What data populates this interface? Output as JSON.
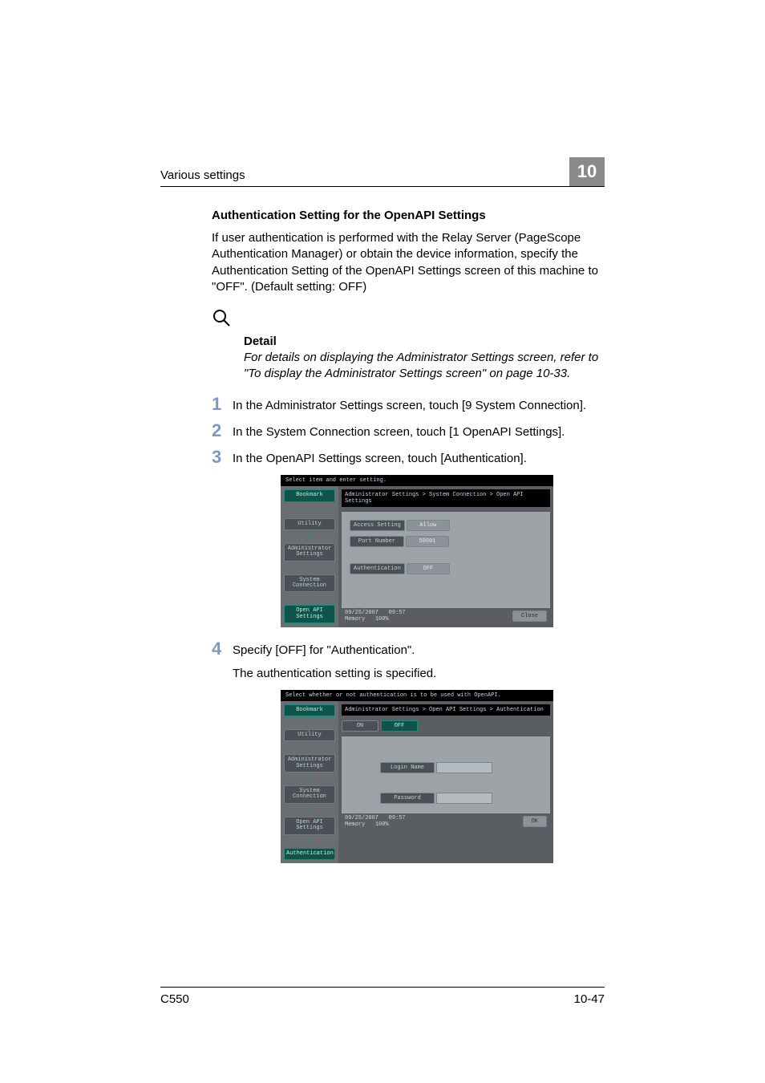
{
  "header": {
    "section": "Various settings",
    "chapter_number": "10"
  },
  "heading": "Authentication Setting for the OpenAPI Settings",
  "intro": "If user authentication is performed with the Relay Server (PageScope Authentication Manager) or obtain the device information, specify the Authentication Setting of the OpenAPI Settings screen of this machine to \"OFF\". (Default setting: OFF)",
  "detail": {
    "title": "Detail",
    "body": "For details on displaying the Administrator Settings screen, refer to \"To display the Administrator Settings screen\" on page 10-33."
  },
  "steps": {
    "s1": {
      "n": "1",
      "t": "In the Administrator Settings screen, touch [9 System Connection]."
    },
    "s2": {
      "n": "2",
      "t": "In the System Connection screen, touch [1 OpenAPI Settings]."
    },
    "s3": {
      "n": "3",
      "t": "In the OpenAPI Settings screen, touch [Authentication]."
    },
    "s4": {
      "n": "4",
      "t": "Specify [OFF] for \"Authentication\"."
    },
    "s4b": "The authentication setting is specified."
  },
  "shot1": {
    "title": "Select item and enter setting.",
    "breadcrumb": "Administrator Settings > System Connection > Open API Settings",
    "side": {
      "bookmark": "Bookmark",
      "utility": "Utility",
      "admin": "Administrator\nSettings",
      "system": "System\nConnection",
      "openapi": "Open API\nSettings"
    },
    "rows": {
      "access": {
        "label": "Access Setting",
        "value": "Allow"
      },
      "port": {
        "label": "Port Number",
        "value": "50001"
      },
      "auth": {
        "label": "Authentication",
        "value": "OFF"
      }
    },
    "status": {
      "date": "09/25/2007",
      "time": "09:57",
      "mem_label": "Memory",
      "mem_value": "100%"
    },
    "close": "Close"
  },
  "shot2": {
    "title": "Select whether or not authentication is to be used with OpenAPI.",
    "breadcrumb": "Administrator Settings > Open API Settings > Authentication",
    "side": {
      "bookmark": "Bookmark",
      "utility": "Utility",
      "admin": "Administrator\nSettings",
      "system": "System\nConnection",
      "openapi": "Open API\nSettings",
      "auth": "Authentication"
    },
    "onoff": {
      "on": "ON",
      "off": "OFF"
    },
    "fields": {
      "login": "Login Name",
      "password": "Password"
    },
    "status": {
      "date": "09/25/2007",
      "time": "09:57",
      "mem_label": "Memory",
      "mem_value": "100%"
    },
    "ok": "OK"
  },
  "footer": {
    "model": "C550",
    "page": "10-47"
  }
}
